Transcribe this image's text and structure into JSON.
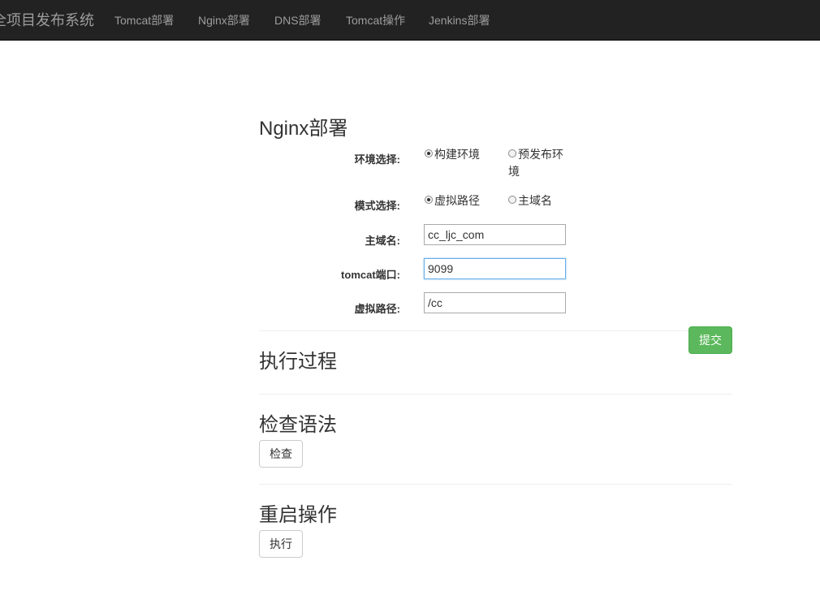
{
  "navbar": {
    "brand": "全项目发布系统",
    "items": [
      {
        "label": "Tomcat部署"
      },
      {
        "label": "Nginx部署"
      },
      {
        "label": "DNS部署"
      },
      {
        "label": "Tomcat操作"
      },
      {
        "label": "Jenkins部署"
      }
    ]
  },
  "form": {
    "title": "Nginx部署",
    "env": {
      "label": "环境选择:",
      "options": [
        {
          "label": "构建环境",
          "checked": true
        },
        {
          "label": "预发布环境",
          "label_line1": "预发布环",
          "label_line2": "境",
          "checked": false
        }
      ]
    },
    "mode": {
      "label": "模式选择:",
      "options": [
        {
          "label": "虚拟路径",
          "checked": true
        },
        {
          "label": "主域名",
          "checked": false
        }
      ]
    },
    "domain": {
      "label": "主域名:",
      "value": "cc_ljc_com"
    },
    "port": {
      "label": "tomcat端口:",
      "value": "9099"
    },
    "path": {
      "label": "虚拟路径:",
      "value": "/cc"
    },
    "submit_label": "提交"
  },
  "process": {
    "title": "执行过程"
  },
  "syntax": {
    "title": "检查语法",
    "button_label": "检查"
  },
  "restart": {
    "title": "重启操作",
    "button_label": "执行"
  },
  "colors": {
    "navbar_bg": "#222222",
    "nav_text": "#9d9d9d",
    "submit_bg": "#5cb85c",
    "focus_border": "#66afe9"
  }
}
